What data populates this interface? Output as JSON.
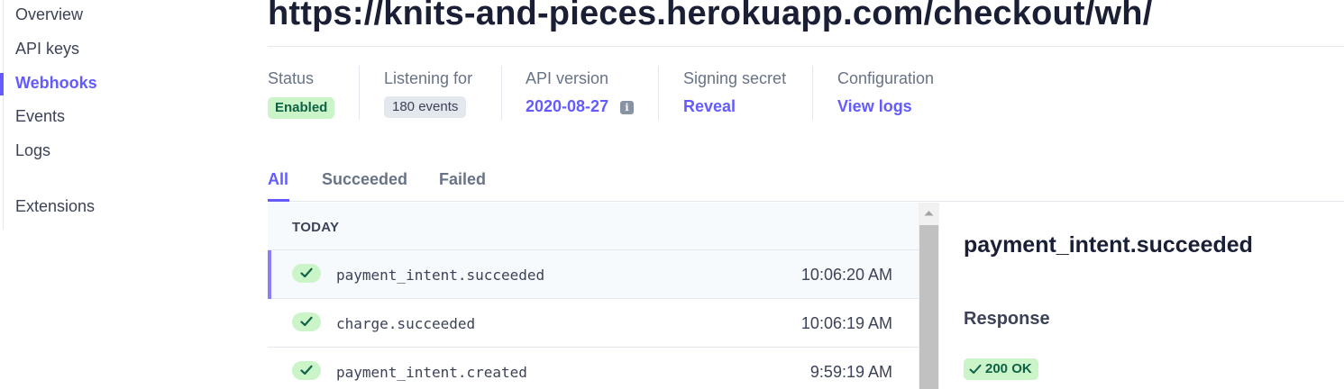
{
  "sidebar": {
    "items": [
      {
        "label": "Overview"
      },
      {
        "label": "API keys"
      },
      {
        "label": "Webhooks",
        "active": true
      },
      {
        "label": "Events"
      },
      {
        "label": "Logs"
      },
      {
        "label": "Extensions"
      }
    ]
  },
  "header": {
    "title": "https://knits-and-pieces.herokuapp.com/checkout/wh/"
  },
  "meta": {
    "status": {
      "label": "Status",
      "value": "Enabled"
    },
    "listening": {
      "label": "Listening for",
      "value": "180 events"
    },
    "api_version": {
      "label": "API version",
      "value": "2020-08-27",
      "icon": "info-icon"
    },
    "signing_secret": {
      "label": "Signing secret",
      "value": "Reveal"
    },
    "configuration": {
      "label": "Configuration",
      "value": "View logs"
    }
  },
  "tabs": [
    {
      "label": "All",
      "active": true
    },
    {
      "label": "Succeeded"
    },
    {
      "label": "Failed"
    }
  ],
  "events": {
    "group_label": "TODAY",
    "rows": [
      {
        "name": "payment_intent.succeeded",
        "time": "10:06:20 AM",
        "status": "success",
        "selected": true
      },
      {
        "name": "charge.succeeded",
        "time": "10:06:19 AM",
        "status": "success"
      },
      {
        "name": "payment_intent.created",
        "time": "9:59:19 AM",
        "status": "success"
      }
    ]
  },
  "detail": {
    "title": "payment_intent.succeeded",
    "response_heading": "Response",
    "response_status": "200 OK"
  },
  "colors": {
    "accent": "#635bff",
    "success_bg": "#cbf4c9",
    "success_text": "#0e6245",
    "muted_text": "#697386"
  }
}
